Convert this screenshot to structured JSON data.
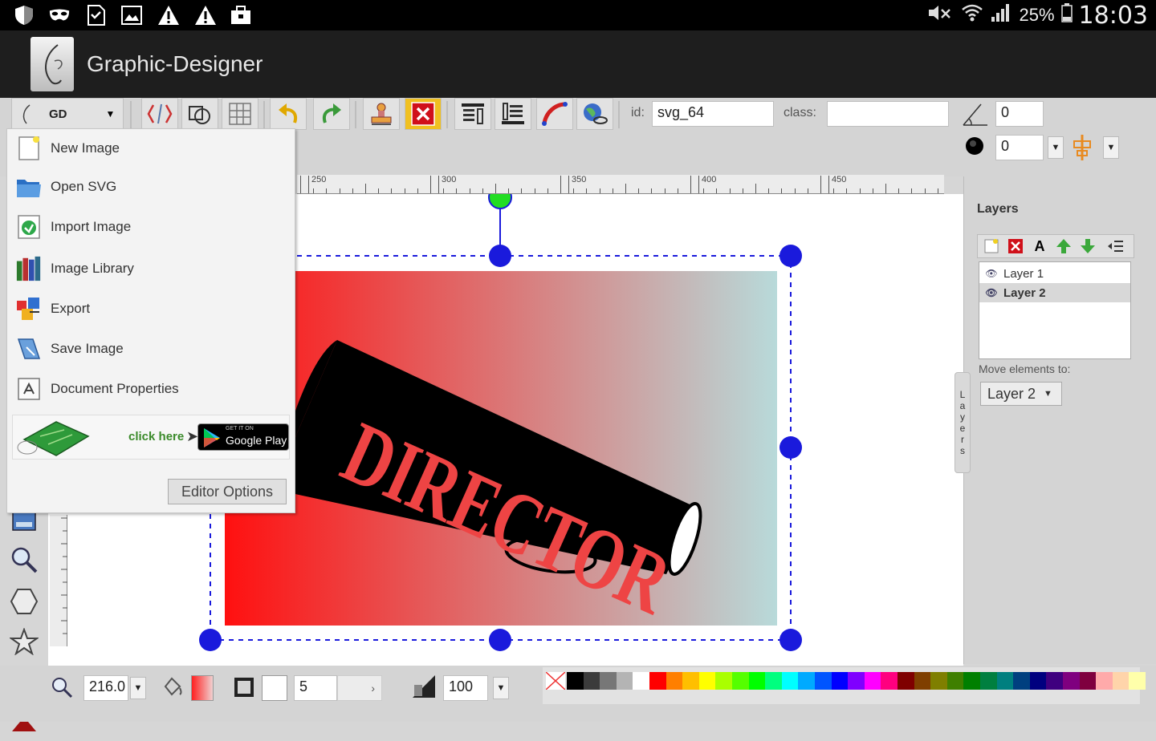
{
  "status": {
    "battery": "25%",
    "time": "18:03"
  },
  "app": {
    "title": "Graphic-Designer"
  },
  "toolbar": {
    "mode_label": "GD",
    "id_label": "id:",
    "id_value": "svg_64",
    "class_label": "class:",
    "class_value": "",
    "angle_value": "0",
    "blur_value": "0"
  },
  "ruler": {
    "labels": [
      "250",
      "300",
      "350",
      "400",
      "450"
    ]
  },
  "menu": {
    "items": [
      {
        "label": "New Image",
        "icon": "new-image-icon"
      },
      {
        "label": "Open SVG",
        "icon": "folder-icon"
      },
      {
        "label": "Import Image",
        "icon": "import-icon"
      },
      {
        "label": "Image Library",
        "icon": "books-icon"
      },
      {
        "label": "Export",
        "icon": "export-icon"
      },
      {
        "label": "Save Image",
        "icon": "save-icon"
      },
      {
        "label": "Document Properties",
        "icon": "properties-icon"
      }
    ],
    "ad_text": "click here",
    "ad_badge_small": "GET IT ON",
    "ad_badge": "Google Play",
    "editor_options": "Editor Options"
  },
  "artwork": {
    "text": "DIRECTOR"
  },
  "layers": {
    "title": "Layers",
    "list": [
      {
        "name": "Layer 1",
        "selected": false
      },
      {
        "name": "Layer 2",
        "selected": true
      }
    ],
    "move_label": "Move elements to:",
    "move_value": "Layer 2",
    "tab_label": "Layers"
  },
  "bottom": {
    "zoom_value": "216.0",
    "stroke_width": "5",
    "opacity": "100"
  },
  "palette": [
    "#000000",
    "#3b3b3b",
    "#777777",
    "#b4b4b4",
    "#ffffff",
    "#ff0000",
    "#ff7f00",
    "#ffbf00",
    "#ffff00",
    "#aaff00",
    "#55ff00",
    "#00ff00",
    "#00ff7f",
    "#00ffff",
    "#00aaff",
    "#0055ff",
    "#0000ff",
    "#7f00ff",
    "#ff00ff",
    "#ff007f",
    "#7f0000",
    "#7f3f00",
    "#7f7f00",
    "#3f7f00",
    "#007f00",
    "#007f3f",
    "#007f7f",
    "#003f7f",
    "#00007f",
    "#3f007f",
    "#7f007f",
    "#7f003f",
    "#ffaaaa",
    "#ffd4aa",
    "#ffffaa"
  ],
  "colors": {
    "selection": "#1a1adc",
    "gradient_start": "#ff1010",
    "gradient_end": "#b8dada"
  }
}
